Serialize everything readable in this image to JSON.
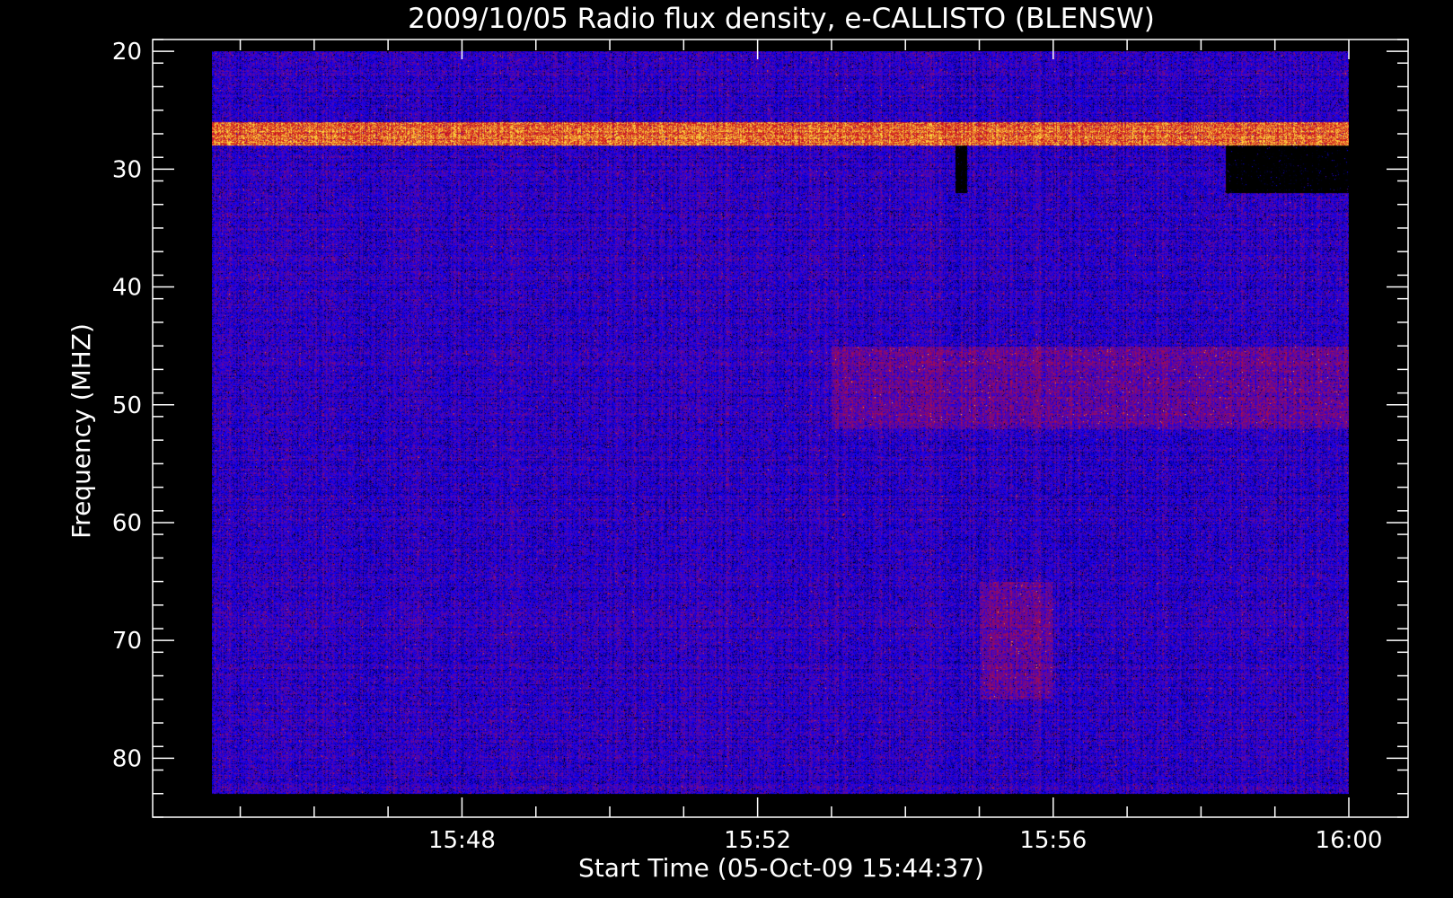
{
  "chart_data": {
    "type": "heatmap",
    "title": "2009/10/05  Radio flux density, e-CALLISTO (BLENSW)",
    "xlabel": "Start Time (05-Oct-09 15:44:37)",
    "ylabel": "Frequency (MHZ)",
    "x_ticks": [
      "15:48",
      "15:52",
      "15:56",
      "16:00"
    ],
    "y_ticks": [
      20,
      30,
      40,
      50,
      60,
      70,
      80
    ],
    "xlim": [
      "15:44:37",
      "16:00"
    ],
    "ylim": [
      85,
      19
    ],
    "y_data_range": [
      20,
      83
    ],
    "colormap": [
      "#000000",
      "#0a00ff",
      "#8a0a6e",
      "#d0101a",
      "#ffe040"
    ],
    "features": [
      {
        "freq_range": [
          26,
          28
        ],
        "time_range": [
          "15:44:37",
          "16:00"
        ],
        "level": "high"
      },
      {
        "freq_range": [
          28,
          32
        ],
        "time_range": [
          "15:58:20",
          "16:00"
        ],
        "level": "low"
      },
      {
        "freq_range": [
          28,
          32
        ],
        "time_range": [
          "15:54:40",
          "15:54:50"
        ],
        "level": "low"
      },
      {
        "freq_range": [
          45,
          52
        ],
        "time_range": [
          "15:53",
          "16:00"
        ],
        "level": "enhanced"
      },
      {
        "freq_range": [
          65,
          75
        ],
        "time_range": [
          "15:55",
          "15:56"
        ],
        "level": "enhanced"
      }
    ],
    "grid": false
  }
}
